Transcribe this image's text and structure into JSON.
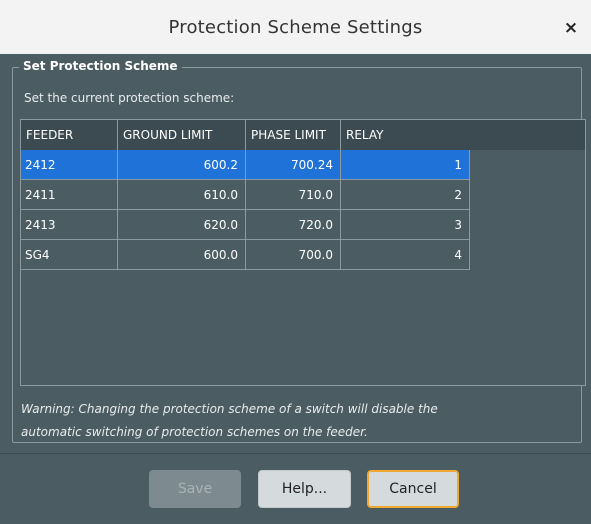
{
  "window": {
    "title": "Protection Scheme Settings",
    "close_label": "×"
  },
  "group": {
    "legend": "Set Protection Scheme",
    "instruction": "Set the current protection scheme:"
  },
  "table": {
    "columns": [
      "FEEDER",
      "GROUND LIMIT",
      "PHASE LIMIT",
      "RELAY"
    ],
    "rows": [
      {
        "feeder": "2412",
        "ground_limit": "600.2",
        "phase_limit": "700.24",
        "relay": "1",
        "selected": true
      },
      {
        "feeder": "2411",
        "ground_limit": "610.0",
        "phase_limit": "710.0",
        "relay": "2",
        "selected": false
      },
      {
        "feeder": "2413",
        "ground_limit": "620.0",
        "phase_limit": "720.0",
        "relay": "3",
        "selected": false
      },
      {
        "feeder": "SG4",
        "ground_limit": "600.0",
        "phase_limit": "700.0",
        "relay": "4",
        "selected": false
      }
    ]
  },
  "warning": {
    "line1": "Warning: Changing the protection scheme of a switch will disable the",
    "line2": "automatic switching of protection schemes on the feeder."
  },
  "buttons": {
    "save_label": "Save",
    "help_label": "Help...",
    "cancel_label": "Cancel"
  },
  "colors": {
    "background": "#4b5c62",
    "selected_row": "#1f73d8",
    "header": "#3b4b51",
    "focus_border": "#f0a830"
  }
}
